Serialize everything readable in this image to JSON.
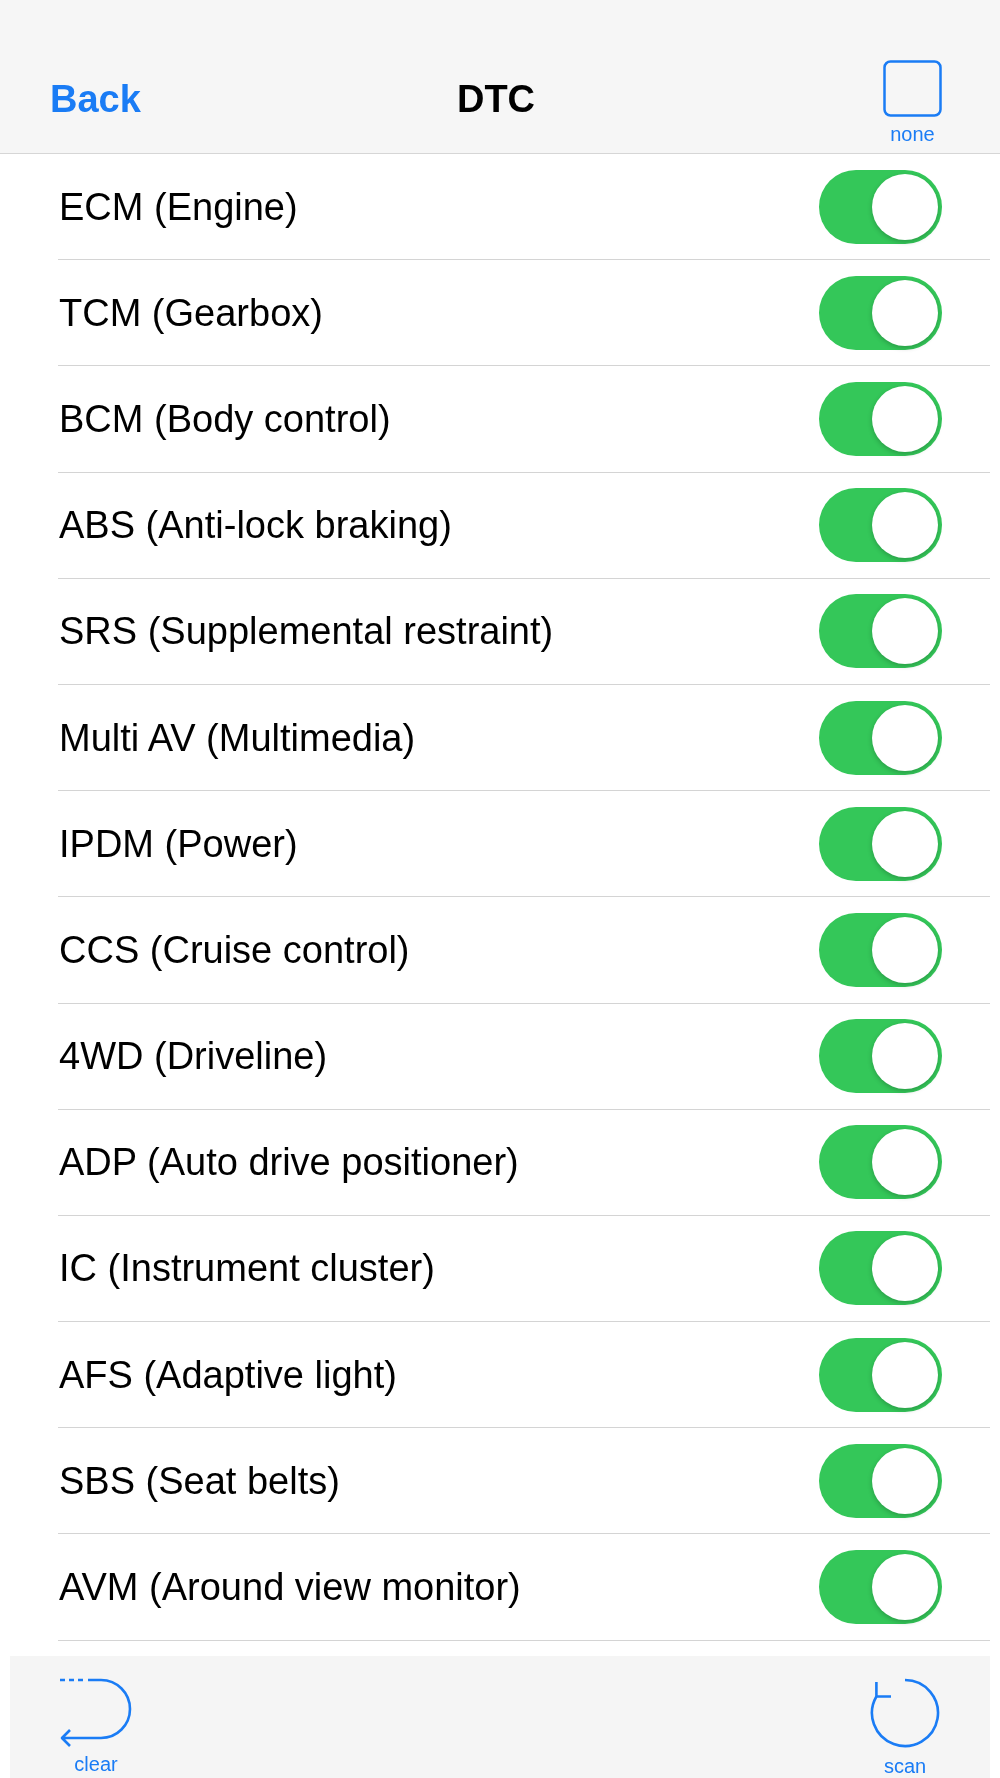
{
  "nav": {
    "back": "Back",
    "title": "DTC",
    "select_all": {
      "label": "none",
      "checked": false
    }
  },
  "modules": [
    {
      "label": "ECM (Engine)",
      "on": true
    },
    {
      "label": "TCM (Gearbox)",
      "on": true
    },
    {
      "label": "BCM (Body control)",
      "on": true
    },
    {
      "label": "ABS (Anti-lock braking)",
      "on": true
    },
    {
      "label": "SRS (Supplemental restraint)",
      "on": true
    },
    {
      "label": "Multi AV (Multimedia)",
      "on": true
    },
    {
      "label": "IPDM (Power)",
      "on": true
    },
    {
      "label": "CCS (Cruise control)",
      "on": true
    },
    {
      "label": "4WD (Driveline)",
      "on": true
    },
    {
      "label": "ADP (Auto drive positioner)",
      "on": true
    },
    {
      "label": "IC (Instrument cluster)",
      "on": true
    },
    {
      "label": "AFS (Adaptive light)",
      "on": true
    },
    {
      "label": "SBS (Seat belts)",
      "on": true
    },
    {
      "label": "AVM (Around view monitor)",
      "on": true
    }
  ],
  "toolbar": [
    {
      "kind": "clear",
      "label": "clear"
    },
    {
      "kind": "scan",
      "label": "scan"
    }
  ]
}
